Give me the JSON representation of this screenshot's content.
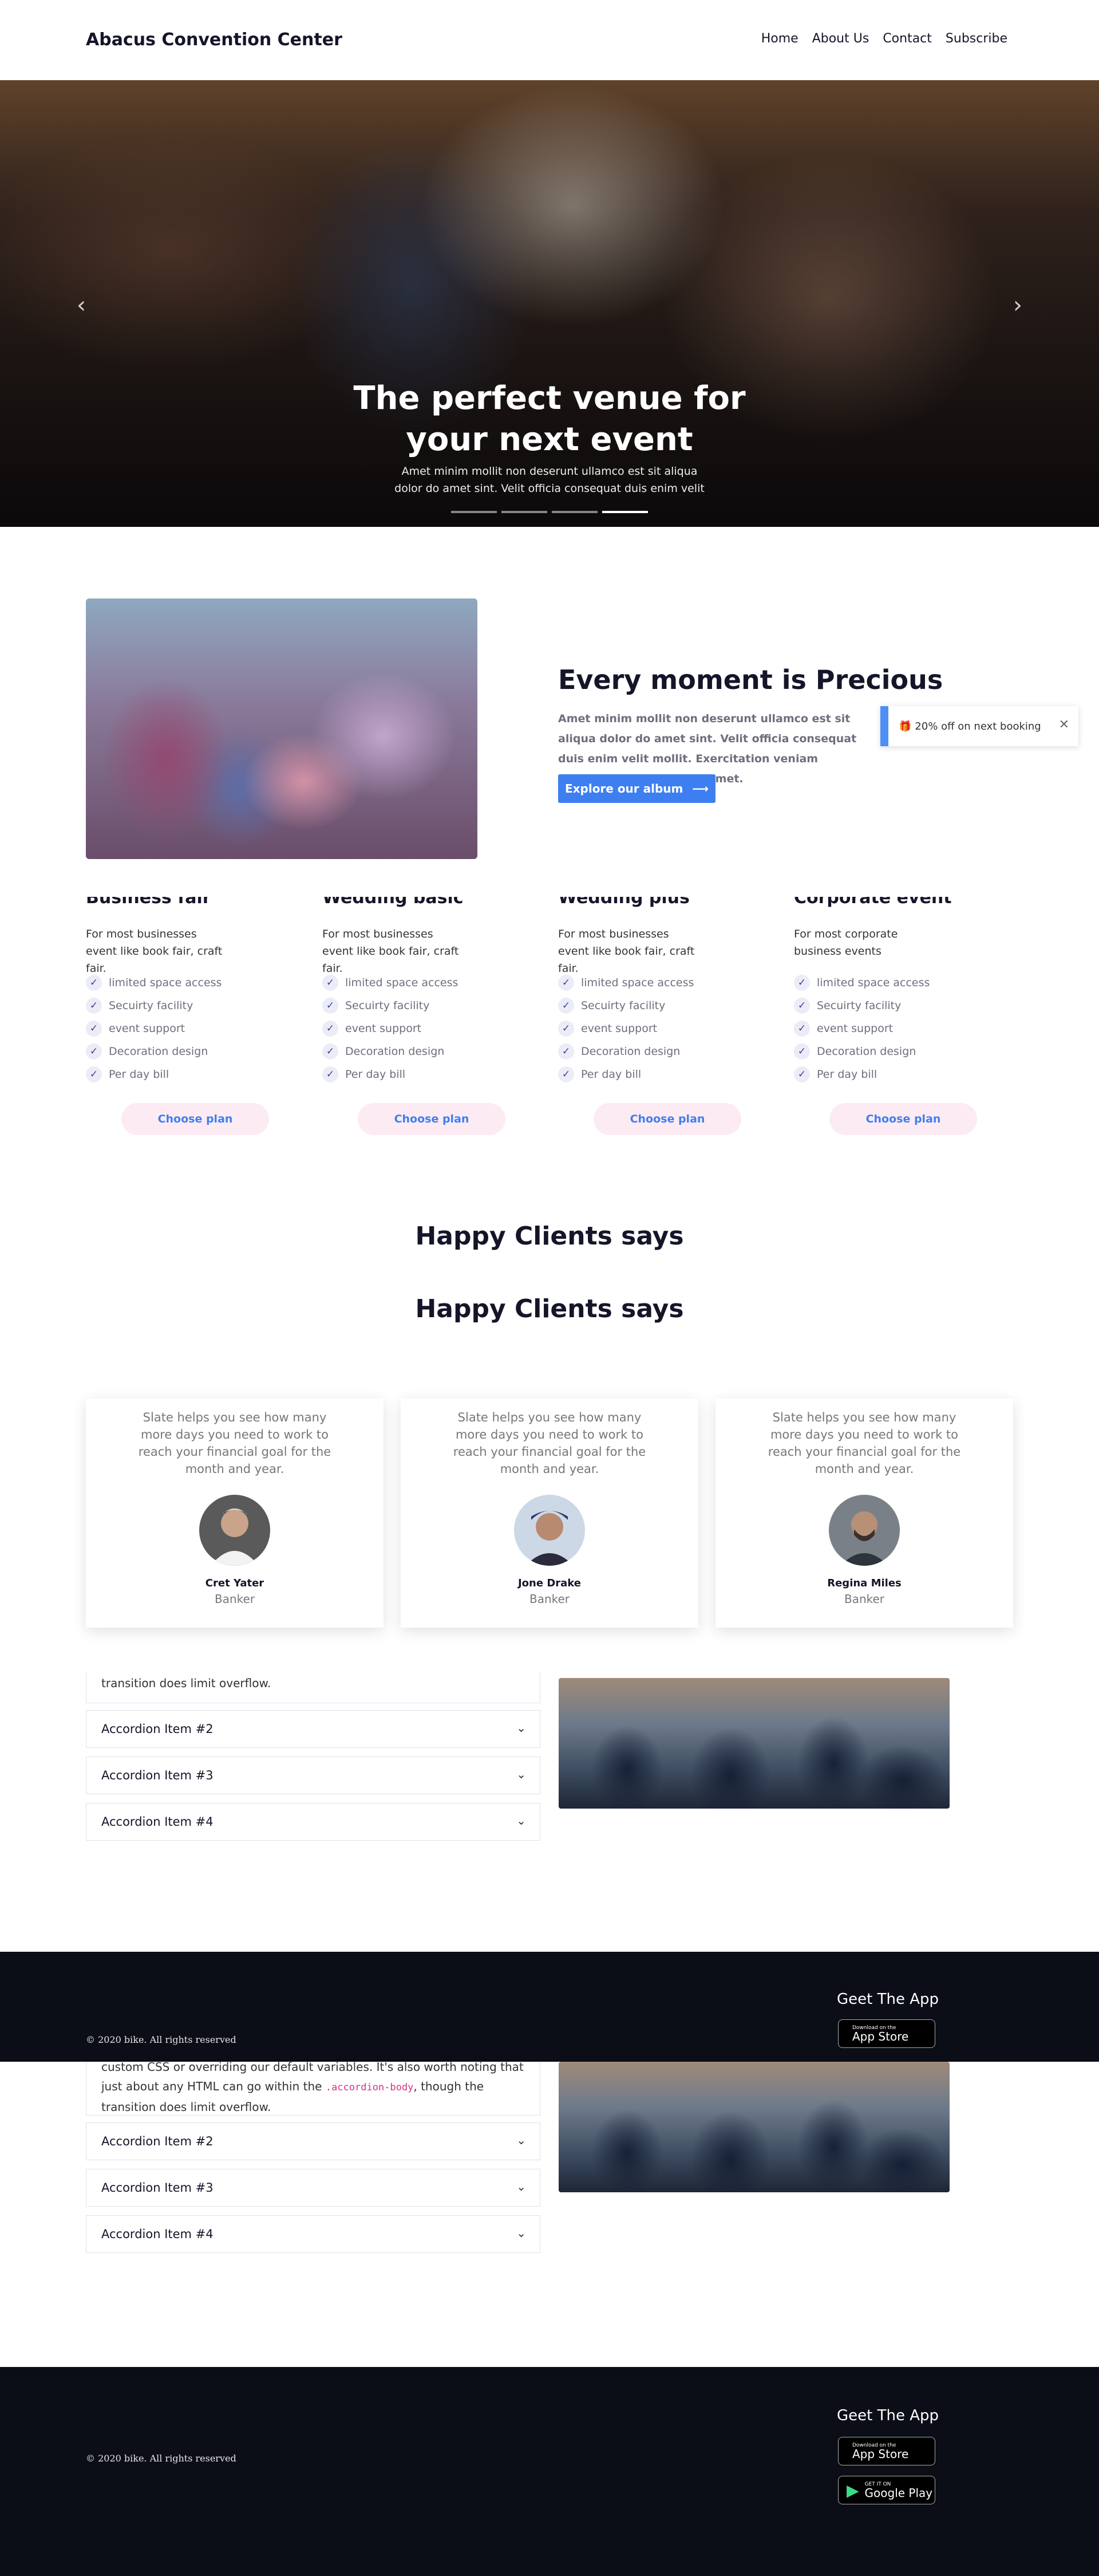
{
  "nav": {
    "brand": "Abacus Convention Center",
    "links": [
      "Home",
      "About Us",
      "Contact",
      "Subscribe"
    ]
  },
  "hero": {
    "title": "The perfect venue for your next event",
    "subtitle": "Amet minim mollit non deserunt ullamco est sit aliqua dolor do amet sint. Velit officia consequat duis enim velit",
    "prev_icon": "chevron-left-icon",
    "next_icon": "chevron-right-icon",
    "slide_count": 4,
    "active_slide": 4
  },
  "about": {
    "title": "Every moment is Precious",
    "text": "Amet minim mollit non deserunt ullamco est sit aliqua dolor do amet sint. Velit officia consequat duis enim velit mollit. Exercitation veniam consequat sunt nostrud amet.",
    "button_label": "Explore our album",
    "toast_text": "20% off on next booking"
  },
  "plans": [
    {
      "name": "Business fair",
      "desc": "For most businesses event like book fair, craft fair.",
      "features": [
        "limited space access",
        "Secuirty facility",
        "event support",
        "Decoration design",
        "Per day bill"
      ],
      "button": "Choose plan"
    },
    {
      "name": "Wedding basic",
      "desc": "For most businesses event like book fair, craft fair.",
      "features": [
        "limited space access",
        "Secuirty facility",
        "event support",
        "Decoration design",
        "Per day bill"
      ],
      "button": "Choose plan"
    },
    {
      "name": "Wedding plus",
      "desc": "For most businesses event like book fair, craft fair.",
      "features": [
        "limited space access",
        "Secuirty facility",
        "event support",
        "Decoration design",
        "Per day bill"
      ],
      "button": "Choose plan"
    },
    {
      "name": "Corporate event",
      "desc": "For most corporate business events",
      "features": [
        "limited space access",
        "Secuirty facility",
        "event support",
        "Decoration design",
        "Per day bill"
      ],
      "button": "Choose plan"
    }
  ],
  "clients": {
    "title": "Happy Clients says",
    "title_repeat": "Happy Clients says",
    "testimonials": [
      {
        "quote": "Slate helps you see how many more days you need to work to reach your financial goal for the month and year.",
        "name": "Cret Yater",
        "role": "Banker"
      },
      {
        "quote": "Slate helps you see how many more days you need to work to reach your financial goal for the month and year.",
        "name": "Jone Drake",
        "role": "Banker"
      },
      {
        "quote": "Slate helps you see how many more days you need to work to reach your financial goal for the month and year.",
        "name": "Regina Miles",
        "role": "Banker"
      }
    ]
  },
  "accordion": {
    "first_body_tail_a": "transition does limit overflow.",
    "first_body_b_line1": "custom CSS or overriding our default variables. It's also worth noting that",
    "first_body_b_line2a": "just about any HTML can go within the ",
    "first_body_b_code": ".accordion-body",
    "first_body_b_line2b": ", though the",
    "first_body_b_line3": "transition does limit overflow.",
    "items": [
      "Accordion Item #2",
      "Accordion Item #3",
      "Accordion Item #4"
    ]
  },
  "footer": {
    "copyright": "© 2020 bike. All rights reserved",
    "app_title": "Geet The App",
    "appstore_small": "Download on the",
    "appstore_big": "App Store",
    "googleplay_small": "GET IT ON",
    "googleplay_big": "Google Play"
  }
}
